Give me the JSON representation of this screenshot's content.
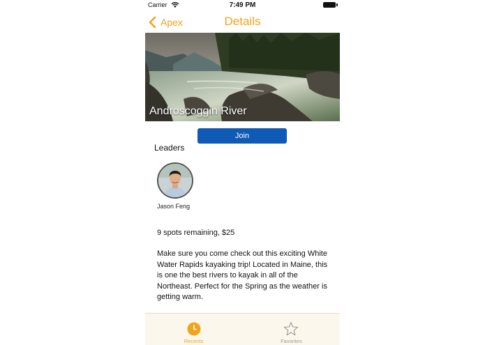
{
  "status_bar": {
    "carrier": "Carrier",
    "time": "7:49 PM"
  },
  "nav": {
    "back_label": "Apex",
    "title": "Details"
  },
  "hero": {
    "caption": "Androscoggin River"
  },
  "join_label": "Join",
  "leaders": {
    "heading": "Leaders",
    "items": [
      {
        "name": "Jason Feng"
      }
    ]
  },
  "spots_text": "9 spots remaining, $25",
  "description": "Make sure you come check out this exciting White Water Rapids kayaking trip! Located in Maine, this is one the best rivers to kayak in all of the Northeast. Perfect for the Spring as the weather is getting warm.",
  "tabs": [
    {
      "label": "Recents",
      "icon": "clock-icon",
      "active": true
    },
    {
      "label": "Favorites",
      "icon": "star-icon",
      "active": false
    }
  ],
  "colors": {
    "accent": "#f0a41c",
    "join_button": "#0e5ab5",
    "tab_bar": "#fbf7ed"
  }
}
